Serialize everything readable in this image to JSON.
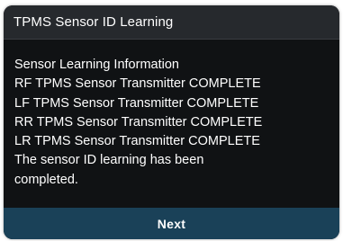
{
  "dialog": {
    "title": "TPMS Sensor ID Learning",
    "lines": [
      "Sensor Learning Information",
      "RF TPMS Sensor Transmitter COMPLETE",
      "LF TPMS Sensor Transmitter COMPLETE",
      "RR TPMS Sensor Transmitter COMPLETE",
      "LR TPMS Sensor Transmitter COMPLETE",
      "The sensor ID learning has been",
      "completed."
    ],
    "next_label": "Next"
  },
  "colors": {
    "dialog_background": "#101214",
    "title_bar": "#26292d",
    "button_background": "#1a4158",
    "text": "#ffffff"
  }
}
